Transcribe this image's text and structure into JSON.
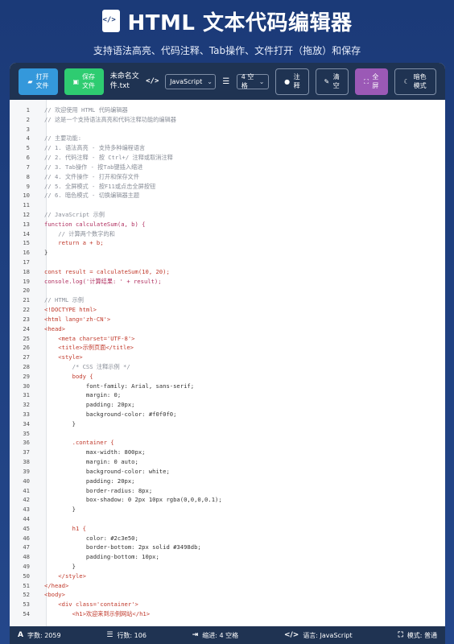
{
  "header": {
    "title": "HTML 文本代码编辑器",
    "subtitle": "支持语法高亮、代码注释、Tab操作、文件打开（拖放）和保存"
  },
  "toolbar": {
    "open_label": "打开文件",
    "save_label": "保存文件",
    "filename": "未命名文件.txt",
    "language": "JavaScript",
    "indent": "4 空格",
    "comment_label": "注释",
    "clear_label": "清空",
    "fullscreen_label": "全屏",
    "dark_label": "暗色模式"
  },
  "colors": {
    "background": "#1b3a78",
    "toolbar": "#1f3352",
    "open": "#3498db",
    "save": "#2ecc71",
    "fullscreen": "#9b59b6"
  },
  "editor": {
    "lines": [
      "// 欢迎使用 HTML 代码编辑器",
      "// 这是一个支持语法高亮和代码注释功能的编辑器",
      "",
      "// 主要功能:",
      "// 1. 语法高亮 - 支持多种编程语言",
      "// 2. 代码注释 - 按 Ctrl+/ 注释或取消注释",
      "// 3. Tab操作 - 按Tab键插入缩进",
      "// 4. 文件操作 - 打开和保存文件",
      "// 5. 全屏模式 - 按F11或点击全屏按钮",
      "// 6. 暗色模式 - 切换编辑器主题",
      "",
      "// JavaScript 示例",
      "function calculateSum(a, b) {",
      "    // 计算两个数字的和",
      "    return a + b;",
      "}",
      "",
      "const result = calculateSum(10, 20);",
      "console.log('计算结果: ' + result);",
      "",
      "// HTML 示例",
      "<!DOCTYPE html>",
      "<html lang='zh-CN'>",
      "<head>",
      "    <meta charset='UTF-8'>",
      "    <title>示例页面</title>",
      "    <style>",
      "        /* CSS 注释示例 */",
      "        body {",
      "            font-family: Arial, sans-serif;",
      "            margin: 0;",
      "            padding: 20px;",
      "            background-color: #f0f0f0;",
      "        }",
      "",
      "        .container {",
      "            max-width: 800px;",
      "            margin: 0 auto;",
      "            background-color: white;",
      "            padding: 20px;",
      "            border-radius: 8px;",
      "            box-shadow: 0 2px 10px rgba(0,0,0,0.1);",
      "        }",
      "",
      "        h1 {",
      "            color: #2c3e50;",
      "            border-bottom: 2px solid #3498db;",
      "            padding-bottom: 10px;",
      "        }",
      "    </style>",
      "</head>",
      "<body>",
      "    <div class='container'>",
      "        <h1>欢迎来到示例网站</h1>"
    ],
    "line_types": [
      "comment",
      "comment",
      "",
      "comment",
      "comment",
      "comment",
      "comment",
      "comment",
      "comment",
      "comment",
      "",
      "comment",
      "fn",
      "comment",
      "kw",
      "",
      "",
      "kw",
      "fn",
      "",
      "comment",
      "tag",
      "tag",
      "tag",
      "tag",
      "tag",
      "tag",
      "comment",
      "kw",
      "",
      "",
      "",
      "",
      "",
      "",
      "kw",
      "",
      "",
      "",
      "",
      "",
      "",
      "",
      "",
      "kw",
      "",
      "",
      "",
      "",
      "tag",
      "tag",
      "tag",
      "tag",
      "tag"
    ]
  },
  "status": {
    "chars": "字数: 2059",
    "lines": "行数: 106",
    "indent": "缩进: 4 空格",
    "lang": "语言: JavaScript",
    "mode": "模式: 普通"
  }
}
